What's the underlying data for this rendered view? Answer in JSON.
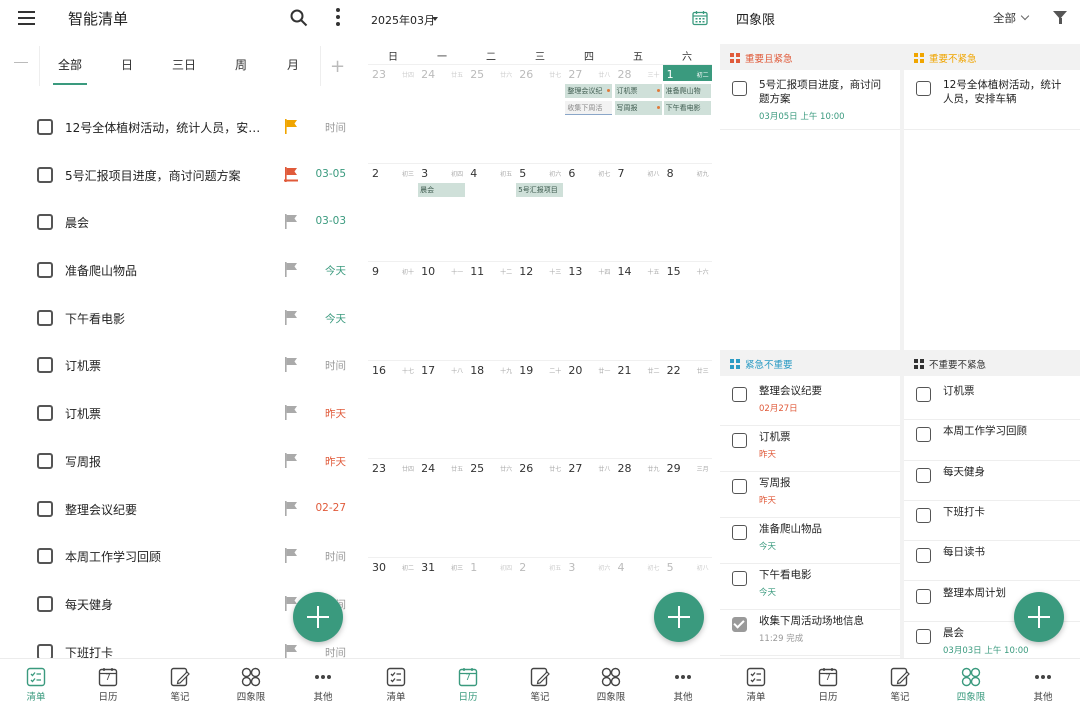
{
  "colors": {
    "accent": "#3a9a7e",
    "red": "#e05a3a",
    "green": "#3a9a7e",
    "gray": "#999999"
  },
  "p1": {
    "title": "智能清单",
    "tabs": [
      "全部",
      "日",
      "三日",
      "周",
      "月"
    ],
    "items": [
      {
        "text": "12号全体植树活动，统计人员，安排…",
        "when": "时间",
        "flag": "orange",
        "status": "gray"
      },
      {
        "text": "5号汇报项目进度，商讨问题方案",
        "when": "03-05",
        "flag": "red",
        "status": "green"
      },
      {
        "text": "晨会",
        "when": "03-03",
        "flag": "gray",
        "status": "green"
      },
      {
        "text": "准备爬山物品",
        "when": "今天",
        "flag": "gray",
        "status": "green"
      },
      {
        "text": "下午看电影",
        "when": "今天",
        "flag": "gray",
        "status": "green"
      },
      {
        "text": "订机票",
        "when": "时间",
        "flag": "gray",
        "status": "gray"
      },
      {
        "text": "订机票",
        "when": "昨天",
        "flag": "gray",
        "status": "red"
      },
      {
        "text": "写周报",
        "when": "昨天",
        "flag": "gray",
        "status": "red"
      },
      {
        "text": "整理会议纪要",
        "when": "02-27",
        "flag": "gray",
        "status": "red"
      },
      {
        "text": "本周工作学习回顾",
        "when": "时间",
        "flag": "gray",
        "status": "gray"
      },
      {
        "text": "每天健身",
        "when": "时间",
        "flag": "gray",
        "status": "gray"
      },
      {
        "text": "下班打卡",
        "when": "时间",
        "flag": "gray",
        "status": "gray"
      }
    ]
  },
  "nav": [
    {
      "label": "清单",
      "icon": "checklist-icon"
    },
    {
      "label": "日历",
      "icon": "calendar-icon",
      "day": "7"
    },
    {
      "label": "笔记",
      "icon": "note-icon"
    },
    {
      "label": "四象限",
      "icon": "quadrant-icon"
    },
    {
      "label": "其他",
      "icon": "more-icon"
    }
  ],
  "p2": {
    "month": "2025年03月",
    "weekdays": [
      "日",
      "一",
      "二",
      "三",
      "四",
      "五",
      "六"
    ],
    "weeks": [
      [
        {
          "d": "23",
          "l": "廿四",
          "dim": true
        },
        {
          "d": "24",
          "l": "廿五",
          "dim": true
        },
        {
          "d": "25",
          "l": "廿六",
          "dim": true
        },
        {
          "d": "26",
          "l": "廿七",
          "dim": true
        },
        {
          "d": "27",
          "l": "廿八",
          "dim": true
        },
        {
          "d": "28",
          "l": "三十",
          "dim": true
        },
        {
          "d": "1",
          "l": "初二",
          "today": true
        }
      ],
      [
        {
          "d": "2",
          "l": "初三"
        },
        {
          "d": "3",
          "l": "初四"
        },
        {
          "d": "4",
          "l": "初五"
        },
        {
          "d": "5",
          "l": "初六"
        },
        {
          "d": "6",
          "l": "初七"
        },
        {
          "d": "7",
          "l": "初八"
        },
        {
          "d": "8",
          "l": "初九"
        }
      ],
      [
        {
          "d": "9",
          "l": "初十"
        },
        {
          "d": "10",
          "l": "十一"
        },
        {
          "d": "11",
          "l": "十二"
        },
        {
          "d": "12",
          "l": "十三"
        },
        {
          "d": "13",
          "l": "十四"
        },
        {
          "d": "14",
          "l": "十五"
        },
        {
          "d": "15",
          "l": "十六"
        }
      ],
      [
        {
          "d": "16",
          "l": "十七"
        },
        {
          "d": "17",
          "l": "十八"
        },
        {
          "d": "18",
          "l": "十九"
        },
        {
          "d": "19",
          "l": "二十"
        },
        {
          "d": "20",
          "l": "廿一"
        },
        {
          "d": "21",
          "l": "廿二"
        },
        {
          "d": "22",
          "l": "廿三"
        }
      ],
      [
        {
          "d": "23",
          "l": "廿四"
        },
        {
          "d": "24",
          "l": "廿五"
        },
        {
          "d": "25",
          "l": "廿六"
        },
        {
          "d": "26",
          "l": "廿七"
        },
        {
          "d": "27",
          "l": "廿八"
        },
        {
          "d": "28",
          "l": "廿九"
        },
        {
          "d": "29",
          "l": "三月"
        }
      ],
      [
        {
          "d": "30",
          "l": "初二"
        },
        {
          "d": "31",
          "l": "初三"
        },
        {
          "d": "1",
          "l": "初四",
          "dim": true
        },
        {
          "d": "2",
          "l": "初五",
          "dim": true
        },
        {
          "d": "3",
          "l": "初六",
          "dim": true
        },
        {
          "d": "4",
          "l": "初七",
          "dim": true
        },
        {
          "d": "5",
          "l": "初八",
          "dim": true
        }
      ]
    ],
    "events": {
      "w0d4": [
        {
          "t": "整理会议纪",
          "dot": true
        },
        {
          "t": "收集下周活",
          "outline": true
        }
      ],
      "w0d5": [
        {
          "t": "订机票",
          "dot": true
        },
        {
          "t": "写周报",
          "dot": true
        }
      ],
      "w0d6": [
        {
          "t": "准备爬山物"
        },
        {
          "t": "下午看电影"
        }
      ],
      "w1d1": [
        {
          "t": "晨会"
        }
      ],
      "w1d3": [
        {
          "t": "5号汇报项目"
        }
      ]
    }
  },
  "p3": {
    "title": "四象限",
    "filter": "全部",
    "q1": {
      "label": "重要且紧急",
      "items": [
        {
          "t": "5号汇报项目进度，商讨问题方案",
          "s": "03月05日 上午 10:00"
        }
      ]
    },
    "q2": {
      "label": "重要不紧急",
      "items": [
        {
          "t": "12号全体植树活动，统计人员，安排车辆",
          "s": ""
        }
      ]
    },
    "q3": {
      "label": "紧急不重要",
      "items": [
        {
          "t": "整理会议纪要",
          "s": "02月27日",
          "sc": "red"
        },
        {
          "t": "订机票",
          "s": "昨天",
          "sc": "red"
        },
        {
          "t": "写周报",
          "s": "昨天",
          "sc": "red"
        },
        {
          "t": "准备爬山物品",
          "s": "今天",
          "sc": "green"
        },
        {
          "t": "下午看电影",
          "s": "今天",
          "sc": "green"
        },
        {
          "t": "收集下周活动场地信息",
          "s": "11:29 完成",
          "sc": "gray",
          "done": true
        }
      ]
    },
    "q4": {
      "label": "不重要不紧急",
      "items": [
        {
          "t": "订机票",
          "s": ""
        },
        {
          "t": "本周工作学习回顾",
          "s": ""
        },
        {
          "t": "每天健身",
          "s": ""
        },
        {
          "t": "下班打卡",
          "s": ""
        },
        {
          "t": "每日读书",
          "s": ""
        },
        {
          "t": "整理本周计划",
          "s": ""
        },
        {
          "t": "晨会",
          "s": "03月03日 上午 10:00",
          "sc": "green"
        }
      ]
    }
  }
}
